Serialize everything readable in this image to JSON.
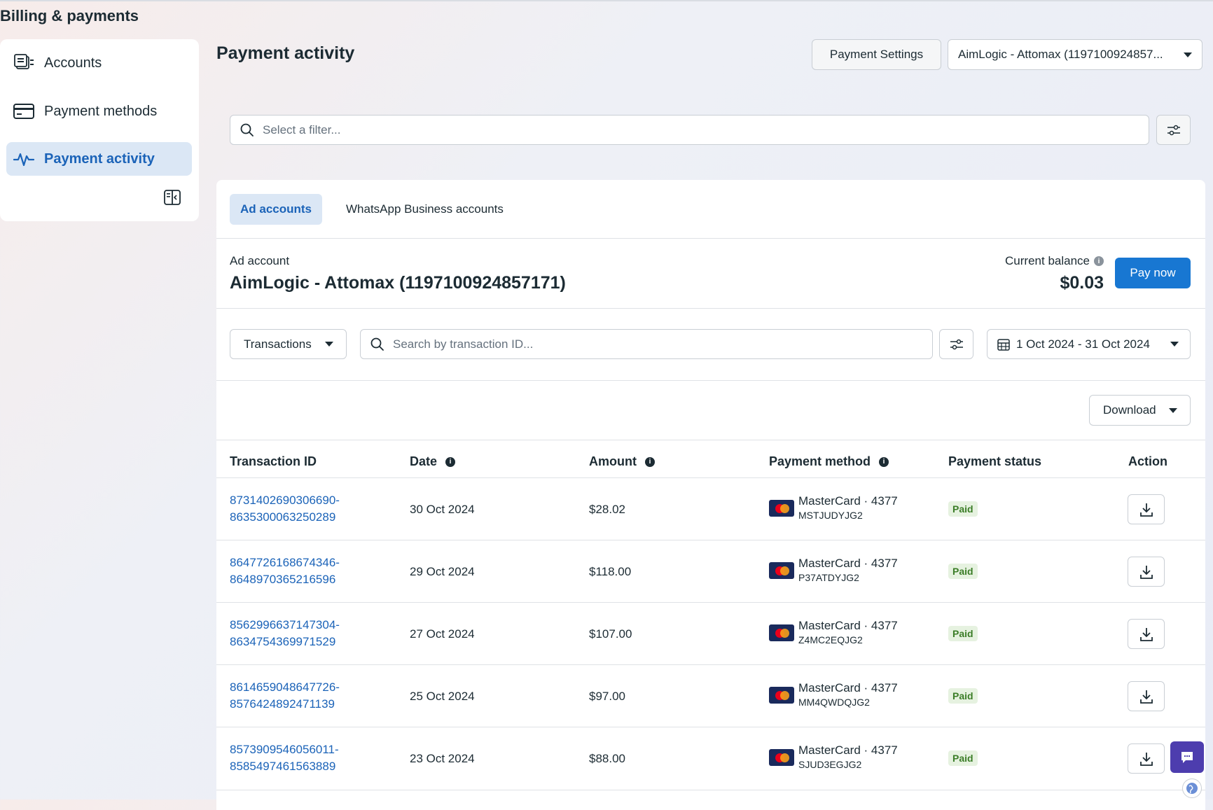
{
  "app": {
    "title": "Billing & payments"
  },
  "sidebar": {
    "items": [
      {
        "label": "Accounts",
        "icon": "accounts-icon"
      },
      {
        "label": "Payment methods",
        "icon": "credit-card-icon"
      },
      {
        "label": "Payment activity",
        "icon": "activity-icon",
        "active": true
      }
    ]
  },
  "header": {
    "title": "Payment activity",
    "settings_label": "Payment Settings",
    "account_selector": "AimLogic - Attomax (1197100924857..."
  },
  "filter": {
    "placeholder": "Select a filter..."
  },
  "tabs": [
    {
      "label": "Ad accounts",
      "active": true
    },
    {
      "label": "WhatsApp Business accounts"
    }
  ],
  "account": {
    "label": "Ad account",
    "name": "AimLogic - Attomax (1197100924857171)",
    "balance_label": "Current balance",
    "balance": "$0.03",
    "pay_label": "Pay now"
  },
  "toolbar": {
    "type_label": "Transactions",
    "search_placeholder": "Search by transaction ID...",
    "date_range": "1 Oct 2024 - 31 Oct 2024",
    "download_label": "Download"
  },
  "table": {
    "headers": [
      "Transaction ID",
      "Date",
      "Amount",
      "Payment method",
      "Payment status",
      "Action"
    ],
    "rows": [
      {
        "id1": "8731402690306690-",
        "id2": "8635300063250289",
        "date": "30 Oct 2024",
        "amount": "$28.02",
        "method": "MasterCard · 4377",
        "ref": "MSTJUDYJG2",
        "status": "Paid"
      },
      {
        "id1": "8647726168674346-",
        "id2": "8648970365216596",
        "date": "29 Oct 2024",
        "amount": "$118.00",
        "method": "MasterCard · 4377",
        "ref": "P37ATDYJG2",
        "status": "Paid"
      },
      {
        "id1": "8562996637147304-",
        "id2": "8634754369971529",
        "date": "27 Oct 2024",
        "amount": "$107.00",
        "method": "MasterCard · 4377",
        "ref": "Z4MC2EQJG2",
        "status": "Paid"
      },
      {
        "id1": "8614659048647726-",
        "id2": "8576424892471139",
        "date": "25 Oct 2024",
        "amount": "$97.00",
        "method": "MasterCard · 4377",
        "ref": "MM4QWDQJG2",
        "status": "Paid"
      },
      {
        "id1": "8573909546056011-",
        "id2": "8585497461563889",
        "date": "23 Oct 2024",
        "amount": "$88.00",
        "method": "MasterCard · 4377",
        "ref": "SJUD3EGJG2",
        "status": "Paid"
      }
    ]
  },
  "colors": {
    "accent": "#1877d2",
    "link": "#1b63b8",
    "paid_bg": "#e6f2e0",
    "paid_text": "#3b7d27"
  }
}
